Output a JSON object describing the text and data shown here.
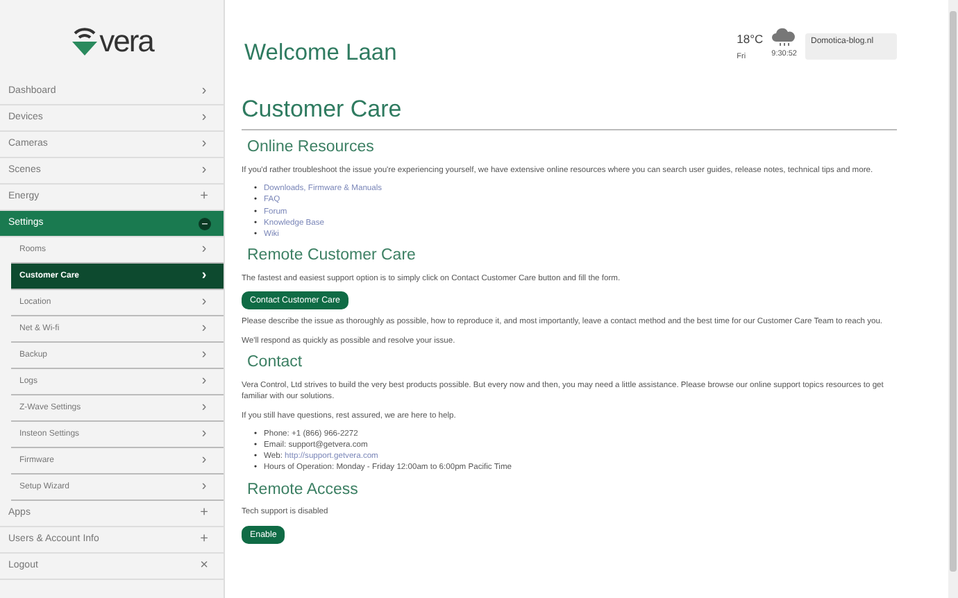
{
  "logo": {
    "text": "vera"
  },
  "sidebar": {
    "items": [
      {
        "label": "Dashboard",
        "icon": "›",
        "selected": false
      },
      {
        "label": "Devices",
        "icon": "›",
        "selected": false
      },
      {
        "label": "Cameras",
        "icon": "›",
        "selected": false
      },
      {
        "label": "Scenes",
        "icon": "›",
        "selected": false
      },
      {
        "label": "Energy",
        "icon": "+",
        "selected": false
      },
      {
        "label": "Settings",
        "icon": "−",
        "selected": false,
        "expanded": true,
        "children": [
          {
            "label": "Rooms",
            "icon": "›",
            "selected": false
          },
          {
            "label": "Customer Care",
            "icon": "›",
            "selected": true
          },
          {
            "label": "Location",
            "icon": "›",
            "selected": false
          },
          {
            "label": "Net & Wi-fi",
            "icon": "›",
            "selected": false
          },
          {
            "label": "Backup",
            "icon": "›",
            "selected": false
          },
          {
            "label": "Logs",
            "icon": "›",
            "selected": false
          },
          {
            "label": "Z-Wave Settings",
            "icon": "›",
            "selected": false
          },
          {
            "label": "Insteon Settings",
            "icon": "›",
            "selected": false
          },
          {
            "label": "Firmware",
            "icon": "›",
            "selected": false
          },
          {
            "label": "Setup Wizard",
            "icon": "›",
            "selected": false
          }
        ]
      },
      {
        "label": "Apps",
        "icon": "+",
        "selected": false
      },
      {
        "label": "Users & Account Info",
        "icon": "+",
        "selected": false
      },
      {
        "label": "Logout",
        "icon": "×",
        "selected": false
      }
    ]
  },
  "header": {
    "welcome": "Welcome Laan",
    "temperature": "18°C",
    "day": "Fri",
    "time": "9:30:52",
    "device": "Domotica-blog.nl"
  },
  "page_title": "Customer Care",
  "sections": [
    {
      "title": "Online Resources",
      "blocks": [
        {
          "kind": "text",
          "text": "If you'd rather troubleshoot the issue you're experiencing yourself, we have extensive online resources where you can search user guides, release notes, technical tips and more."
        },
        {
          "kind": "list",
          "bullet": "•",
          "items": [
            {
              "link": "Downloads, Firmware & Manuals"
            },
            {
              "link": "FAQ"
            },
            {
              "link": "Forum"
            },
            {
              "link": "Knowledge Base"
            },
            {
              "link": "Wiki"
            }
          ]
        }
      ]
    },
    {
      "title": "Remote Customer Care",
      "blocks": [
        {
          "kind": "text",
          "text": "The fastest and easiest support option is to simply click on Contact Customer Care button and fill the form."
        },
        {
          "kind": "button",
          "text": "Contact Customer Care"
        },
        {
          "kind": "text",
          "text": "Please describe the issue as thoroughly as possible, how to reproduce it, and most importantly, leave a contact method and the best time for our Customer Care Team to reach you."
        },
        {
          "kind": "text",
          "text": "We'll respond as quickly as possible and resolve your issue."
        }
      ]
    },
    {
      "title": "Contact",
      "blocks": [
        {
          "kind": "text",
          "text": "Vera Control, Ltd strives to build the very best products possible. But every now and then, you may need a little assistance. Please browse our online support topics resources to get familiar with our solutions."
        },
        {
          "kind": "text",
          "text": "If you still have questions, rest assured, we are here to help."
        },
        {
          "kind": "list",
          "bullet": "•",
          "items": [
            {
              "text": "Phone: +1 (866) 966-2272"
            },
            {
              "text": "Email: support@getvera.com"
            },
            {
              "text": "Web: ",
              "link": "http://support.getvera.com"
            },
            {
              "text": "Hours of Operation: Monday - Friday 12:00am to 6:00pm Pacific Time"
            }
          ]
        }
      ]
    },
    {
      "title": "Remote Access",
      "blocks": [
        {
          "kind": "text",
          "text": "Tech support is disabled"
        },
        {
          "kind": "button",
          "text": "Enable"
        }
      ]
    }
  ]
}
